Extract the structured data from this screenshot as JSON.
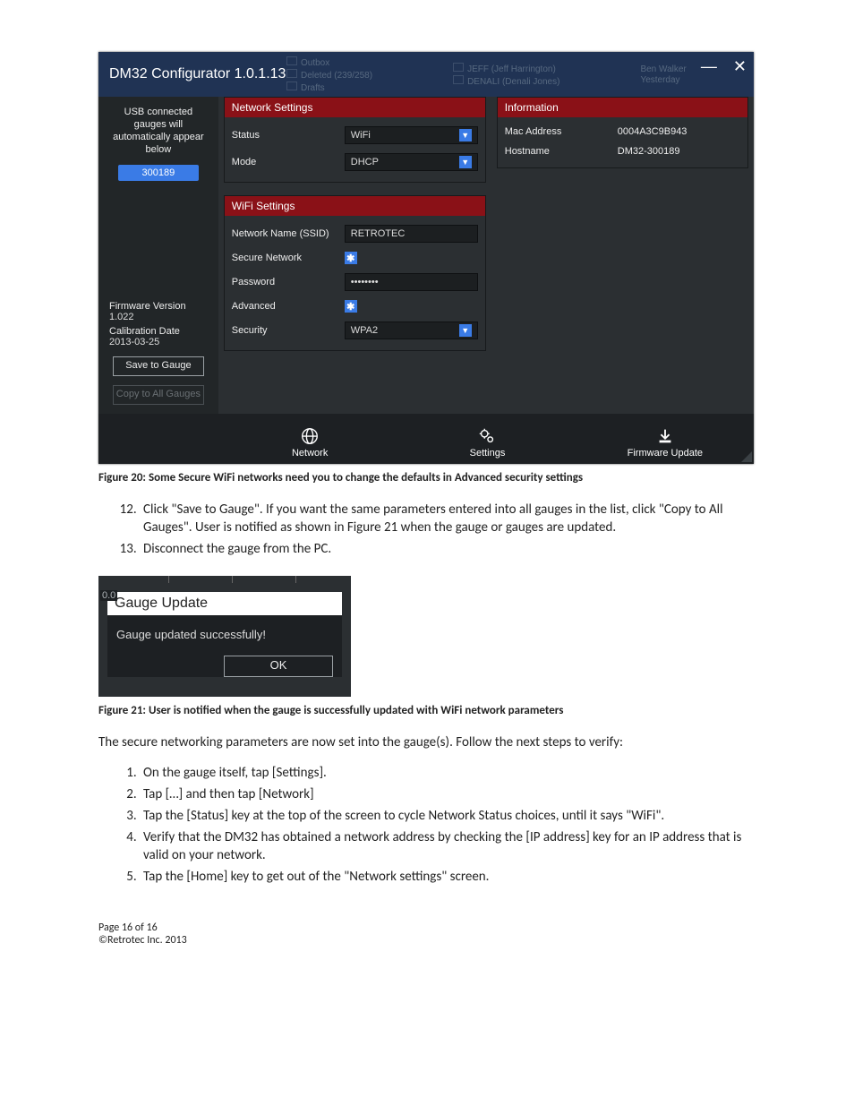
{
  "config": {
    "window_title": "DM32 Configurator 1.0.1.13",
    "win_min": "—",
    "win_close": "✕",
    "ghost": {
      "outbox": "Outbox",
      "deleted": "Deleted (239/258)",
      "drafts": "Drafts",
      "jeff": "JEFF (Jeff Harrington)",
      "denali": "DENALI (Denali Jones)",
      "ben": "Ben Walker",
      "yesterday": "Yesterday"
    },
    "sidebar": {
      "helper1": "USB connected",
      "helper2": "gauges will",
      "helper3": "automatically appear",
      "helper4": "below",
      "device_id": "300189",
      "fw_label": "Firmware Version",
      "fw_value": "1.022",
      "cal_label": "Calibration Date",
      "cal_value": "2013-03-25",
      "save_btn": "Save to Gauge",
      "copy_btn": "Copy to All Gauges"
    },
    "net_panel": {
      "header": "Network Settings",
      "status_label": "Status",
      "status_value": "WiFi",
      "mode_label": "Mode",
      "mode_value": "DHCP"
    },
    "wifi_panel": {
      "header": "WiFi Settings",
      "ssid_label": "Network Name (SSID)",
      "ssid_value": "RETROTEC",
      "secure_label": "Secure Network",
      "password_label": "Password",
      "password_value": "••••••••",
      "advanced_label": "Advanced",
      "security_label": "Security",
      "security_value": "WPA2"
    },
    "info_panel": {
      "header": "Information",
      "mac_label": "Mac Address",
      "mac_value": "0004A3C9B943",
      "host_label": "Hostname",
      "host_value": "DM32-300189"
    },
    "tabs": {
      "network": "Network",
      "settings": "Settings",
      "firmware": "Firmware Update"
    }
  },
  "fig20_caption": "Figure 20:  Some Secure WiFi networks need you to change the defaults in Advanced security settings",
  "step12": "Click \"Save to Gauge\".  If you want the same parameters entered into all gauges in the list, click \"Copy to All Gauges\".  User is notified as shown in Figure 21 when the gauge or gauges are updated.",
  "step13": "Disconnect the gauge from the PC.",
  "dialog": {
    "edge": "0.0",
    "title": "Gauge Update",
    "message": "Gauge updated successfully!",
    "ok": "OK"
  },
  "fig21_caption": "Figure 21:  User is notified when the gauge is successfully updated with WiFi network parameters",
  "para_secure": "The secure networking parameters are now set into the gauge(s).  Follow the next steps to verify:",
  "verify_steps": {
    "s1": "On the gauge itself, tap [Settings].",
    "s2": "Tap […] and then tap [Network]",
    "s3": "Tap the [Status] key at the top of the screen to cycle Network Status choices, until it says \"WiFi\".",
    "s4": "Verify that the DM32 has obtained a network address by checking the [IP address] key for an IP address that is valid on your network.",
    "s5": "Tap the [Home] key to get out of the \"Network settings\" screen."
  },
  "footer_page": "Page 16 of 16",
  "footer_copy": "©Retrotec Inc. 2013"
}
